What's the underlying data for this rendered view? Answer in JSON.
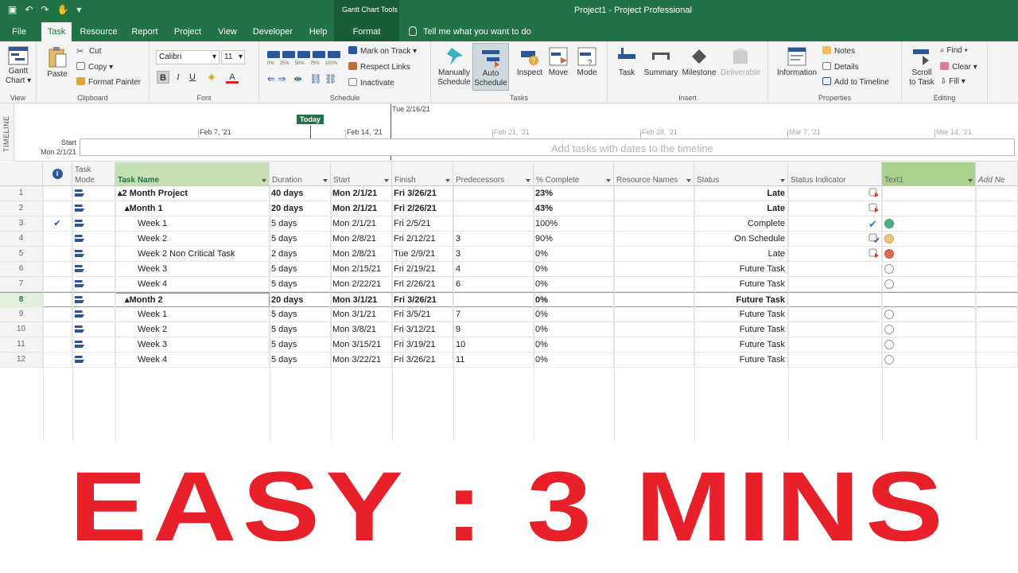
{
  "titlebar": {
    "title": "Project1  -  Project Professional",
    "context_group": "Gantt Chart Tools"
  },
  "tabs": [
    "File",
    "Task",
    "Resource",
    "Report",
    "Project",
    "View",
    "Developer",
    "Help",
    "Format"
  ],
  "active_tab": "Task",
  "tell_me": "Tell me what you want to do",
  "ribbon": {
    "view": {
      "gantt": "Gantt\nChart ▾",
      "label": "View"
    },
    "clipboard": {
      "paste": "Paste",
      "cut": "Cut",
      "copy": "Copy",
      "format_painter": "Format Painter",
      "label": "Clipboard"
    },
    "font": {
      "family": "Calibri",
      "size": "11",
      "bold": "B",
      "italic": "I",
      "underline": "U",
      "label": "Font"
    },
    "schedule": {
      "mark_on_track": "Mark on Track",
      "respect_links": "Respect Links",
      "inactivate": "Inactivate",
      "label": "Schedule",
      "pct": [
        "0%",
        "25%",
        "50%",
        "75%",
        "100%"
      ]
    },
    "tasks": {
      "manually": "Manually\nSchedule",
      "auto": "Auto\nSchedule",
      "inspect": "Inspect",
      "move": "Move",
      "mode": "Mode",
      "label": "Tasks"
    },
    "insert": {
      "task": "Task",
      "summary": "Summary",
      "milestone": "Milestone",
      "deliverable": "Deliverable",
      "label": "Insert"
    },
    "properties": {
      "information": "Information",
      "notes": "Notes",
      "details": "Details",
      "add_timeline": "Add to Timeline",
      "label": "Properties"
    },
    "editing": {
      "scroll": "Scroll\nto Task",
      "find": "Find",
      "clear": "Clear",
      "fill": "Fill",
      "label": "Editing"
    }
  },
  "timeline": {
    "side_label": "TIMELINE",
    "range_end": "Tue 2/16/21",
    "today": "Today",
    "start_label": "Start",
    "start_date": "Mon 2/1/21",
    "dates": [
      "Feb 7, '21",
      "Feb 14, '21",
      "Feb 21, '21",
      "Feb 28, '21",
      "Mar 7, '21",
      "Mar 14, '21"
    ],
    "placeholder": "Add tasks with dates to the timeline"
  },
  "grid": {
    "headers": {
      "task_mode": "Task\nMode",
      "task_name": "Task Name",
      "duration": "Duration",
      "start": "Start",
      "finish": "Finish",
      "predecessors": "Predecessors",
      "pct_complete": "% Complete",
      "resource_names": "Resource Names",
      "status": "Status",
      "status_indicator": "Status Indicator",
      "text1": "Text1",
      "add_new": "Add Ne"
    },
    "rows": [
      {
        "id": "1",
        "name": "▴2 Month Project",
        "duration": "40 days",
        "start": "Mon 2/1/21",
        "finish": "Fri 3/26/21",
        "pred": "",
        "pct": "23%",
        "status": "Late",
        "indicator": "late-icon",
        "dot": "",
        "bold": true,
        "indent": 0
      },
      {
        "id": "2",
        "name": "▴Month 1",
        "duration": "20 days",
        "start": "Mon 2/1/21",
        "finish": "Fri 2/26/21",
        "pred": "",
        "pct": "43%",
        "status": "Late",
        "indicator": "late-icon",
        "dot": "",
        "bold": true,
        "indent": 1
      },
      {
        "id": "3",
        "name": "Week 1",
        "duration": "5 days",
        "start": "Mon 2/1/21",
        "finish": "Fri 2/5/21",
        "pred": "",
        "pct": "100%",
        "status": "Complete",
        "indicator": "check-icon",
        "dot": "#4caf7d",
        "bold": false,
        "indent": 2,
        "done": true
      },
      {
        "id": "4",
        "name": "Week 2",
        "duration": "5 days",
        "start": "Mon 2/8/21",
        "finish": "Fri 2/12/21",
        "pred": "3",
        "pct": "90%",
        "status": "On Schedule",
        "indicator": "on-schedule-icon",
        "dot": "#f2c27a",
        "bold": false,
        "indent": 2
      },
      {
        "id": "5",
        "name": "Week 2 Non Critical Task",
        "duration": "2 days",
        "start": "Mon 2/8/21",
        "finish": "Tue 2/9/21",
        "pred": "3",
        "pct": "0%",
        "status": "Late",
        "indicator": "late-icon",
        "dot": "#e06a4a",
        "bold": false,
        "indent": 2
      },
      {
        "id": "6",
        "name": "Week 3",
        "duration": "5 days",
        "start": "Mon 2/15/21",
        "finish": "Fri 2/19/21",
        "pred": "4",
        "pct": "0%",
        "status": "Future Task",
        "indicator": "",
        "dot": "empty",
        "bold": false,
        "indent": 2
      },
      {
        "id": "7",
        "name": "Week 4",
        "duration": "5 days",
        "start": "Mon 2/22/21",
        "finish": "Fri 2/26/21",
        "pred": "6",
        "pct": "0%",
        "status": "Future Task",
        "indicator": "",
        "dot": "empty",
        "bold": false,
        "indent": 2
      },
      {
        "id": "8",
        "name": "▴Month 2",
        "duration": "20 days",
        "start": "Mon 3/1/21",
        "finish": "Fri 3/26/21",
        "pred": "",
        "pct": "0%",
        "status": "Future Task",
        "indicator": "",
        "dot": "",
        "bold": true,
        "indent": 1,
        "selected": true
      },
      {
        "id": "9",
        "name": "Week 1",
        "duration": "5 days",
        "start": "Mon 3/1/21",
        "finish": "Fri 3/5/21",
        "pred": "7",
        "pct": "0%",
        "status": "Future Task",
        "indicator": "",
        "dot": "empty",
        "bold": false,
        "indent": 2
      },
      {
        "id": "10",
        "name": "Week 2",
        "duration": "5 days",
        "start": "Mon 3/8/21",
        "finish": "Fri 3/12/21",
        "pred": "9",
        "pct": "0%",
        "status": "Future Task",
        "indicator": "",
        "dot": "empty",
        "bold": false,
        "indent": 2
      },
      {
        "id": "11",
        "name": "Week 3",
        "duration": "5 days",
        "start": "Mon 3/15/21",
        "finish": "Fri 3/19/21",
        "pred": "10",
        "pct": "0%",
        "status": "Future Task",
        "indicator": "",
        "dot": "empty",
        "bold": false,
        "indent": 2
      },
      {
        "id": "12",
        "name": "Week 4",
        "duration": "5 days",
        "start": "Mon 3/22/21",
        "finish": "Fri 3/26/21",
        "pred": "11",
        "pct": "0%",
        "status": "Future Task",
        "indicator": "",
        "dot": "empty",
        "bold": false,
        "indent": 2
      }
    ]
  },
  "banner": {
    "text": "EASY : 3 MINS"
  },
  "colors": {
    "brand": "#217346",
    "banner": "#e8202a",
    "accent_blue": "#2b579a"
  }
}
